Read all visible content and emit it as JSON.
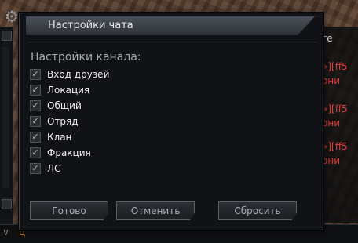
{
  "dialog": {
    "title": "Настройки чата",
    "section_title": "Настройки канала:",
    "options": [
      {
        "label": "Вход друзей",
        "checked": true
      },
      {
        "label": "Локация",
        "checked": true
      },
      {
        "label": "Общий",
        "checked": true
      },
      {
        "label": "Отряд",
        "checked": true
      },
      {
        "label": "Клан",
        "checked": true
      },
      {
        "label": "Фракция",
        "checked": true
      },
      {
        "label": "ЛС",
        "checked": true
      }
    ],
    "buttons": {
      "ok": "Готово",
      "cancel": "Отменить",
      "reset": "Сбросить"
    }
  },
  "background_chat": {
    "right_fragments": [
      "ге",
      "»][ff5",
      "они",
      "»][ff5",
      "они",
      "»][ff5",
      "они"
    ],
    "input_char": "ц"
  }
}
